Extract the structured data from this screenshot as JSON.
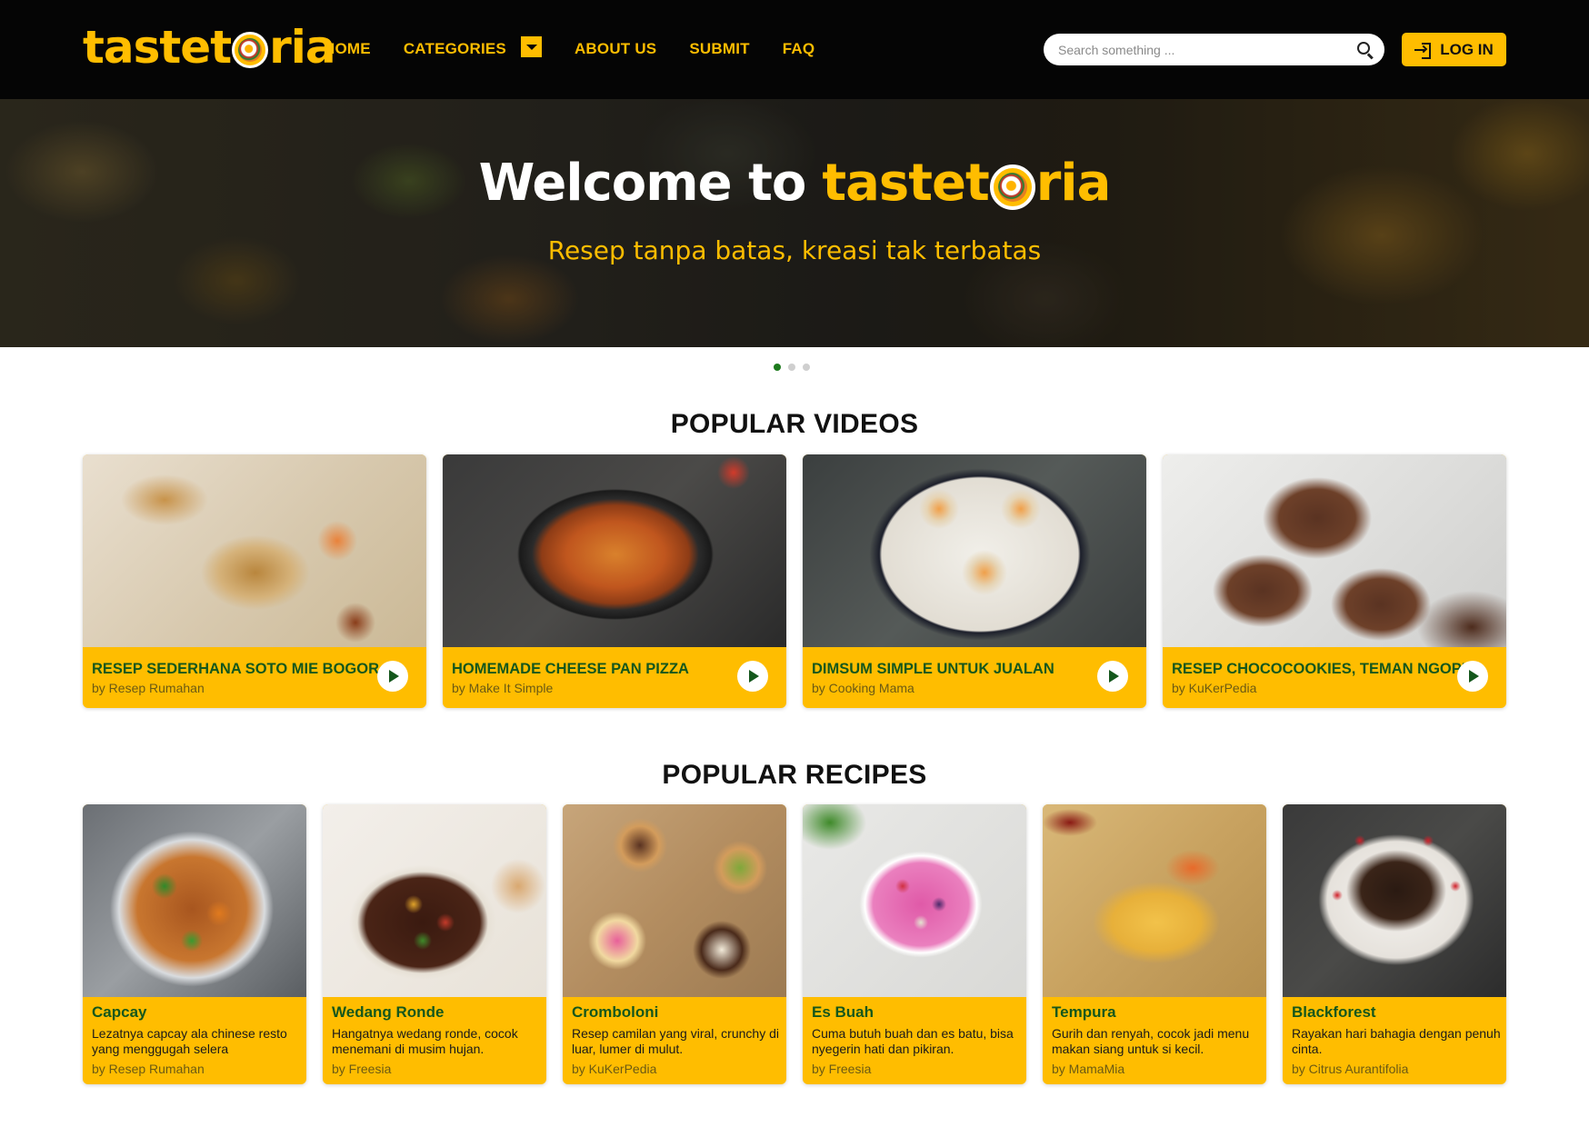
{
  "header": {
    "logo_text_pre": "tastet",
    "logo_text_post": "ria",
    "nav": [
      "HOME",
      "CATEGORIES",
      "ABOUT US",
      "SUBMIT",
      "FAQ"
    ],
    "search_placeholder": "Search something ...",
    "login_label": "LOG IN"
  },
  "hero": {
    "welcome": "Welcome to",
    "brand_pre": "tastet",
    "brand_post": "ria",
    "subtitle": "Resep tanpa batas, kreasi tak terbatas",
    "slide_count": 3,
    "active_slide": 1
  },
  "popular_videos": {
    "title": "POPULAR VIDEOS",
    "items": [
      {
        "title": "RESEP SEDERHANA SOTO MIE BOGOR",
        "by": "by Resep Rumahan"
      },
      {
        "title": "HOMEMADE CHEESE PAN PIZZA",
        "by": "by Make It Simple"
      },
      {
        "title": "DIMSUM SIMPLE UNTUK JUALAN",
        "by": "by Cooking Mama"
      },
      {
        "title": "RESEP CHOCOCOOKIES, TEMAN NGOPI",
        "by": "by KuKerPedia"
      }
    ]
  },
  "popular_recipes": {
    "title": "POPULAR RECIPES",
    "items": [
      {
        "title": "Capcay",
        "desc": "Lezatnya capcay ala chinese resto yang menggugah selera",
        "by": "by Resep Rumahan"
      },
      {
        "title": "Wedang Ronde",
        "desc": "Hangatnya wedang ronde, cocok menemani di musim hujan.",
        "by": "by Freesia"
      },
      {
        "title": "Cromboloni",
        "desc": "Resep camilan yang viral, crunchy di luar, lumer di mulut.",
        "by": "by KuKerPedia"
      },
      {
        "title": "Es Buah",
        "desc": "Cuma butuh buah dan es batu, bisa nyegerin hati dan pikiran.",
        "by": "by Freesia"
      },
      {
        "title": "Tempura",
        "desc": "Gurih dan renyah, cocok jadi menu makan siang untuk si kecil.",
        "by": "by MamaMia"
      },
      {
        "title": "Blackforest",
        "desc": "Rayakan hari bahagia dengan penuh cinta.",
        "by": "by Citrus Aurantifolia"
      }
    ]
  },
  "colors": {
    "accent": "#ffbd00",
    "header_bg": "#050505",
    "title_green": "#14571c",
    "dot_active": "#1d7a1d"
  }
}
